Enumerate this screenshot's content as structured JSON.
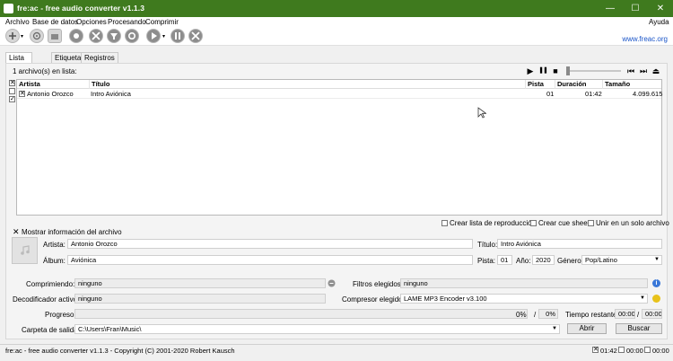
{
  "window": {
    "title": "fre:ac - free audio converter v1.1.3",
    "minimize": "—",
    "maximize": "☐",
    "close": "✕"
  },
  "menu": {
    "items": [
      "Archivo",
      "Base de datos",
      "Opciones",
      "Procesando",
      "Comprimir"
    ],
    "help": "Ayuda"
  },
  "toolbar": {
    "link": "www.freac.org",
    "icons": [
      "add-files-icon",
      "add-cd-icon",
      "add-folder-icon",
      "cddb-query-icon",
      "general-settings-icon",
      "encoder-settings-icon",
      "cover-settings-icon",
      "play-icon",
      "pause-icon",
      "stop-icon"
    ]
  },
  "tabs": [
    "Lista de tareas",
    "Etiquetas",
    "Registros"
  ],
  "joblist": {
    "count_text": "1 archivo(s) en lista:",
    "columns": [
      "Artista",
      "Título",
      "Pista",
      "Duración",
      "Tamaño"
    ],
    "rows": [
      {
        "artist": "Antonio Orozco",
        "title": "Intro Aviónica",
        "track": "01",
        "duration": "01:42",
        "size": "4.099.615"
      }
    ]
  },
  "player": {
    "play": "▶",
    "pause": "❚❚",
    "stop": "■",
    "prev": "⏮",
    "next": "⏭",
    "eject": "⏏"
  },
  "options": {
    "playlist": "Crear lista de reproducción",
    "cuesheet": "Crear cue sheet",
    "single_file": "Unir en un solo archivo"
  },
  "info": {
    "toggle": "Mostrar información del archivo",
    "artist_label": "Artista:",
    "artist": "Antonio Orozco",
    "title_label": "Título:",
    "title": "Intro Aviónica",
    "album_label": "Álbum:",
    "album": "Aviónica",
    "track_label": "Pista:",
    "track": "01",
    "year_label": "Año:",
    "year": "2020",
    "genre_label": "Género:",
    "genre": "Pop/Latino"
  },
  "encoding": {
    "compressing_label": "Comprimiendo:",
    "compressing": "ninguno",
    "filters_label": "Filtros elegidos:",
    "filters": "ninguno",
    "decoder_label": "Decodificador activo:",
    "decoder": "ninguno",
    "encoder_label": "Compresor elegido:",
    "encoder": "LAME MP3 Encoder v3.100",
    "progress_label": "Progreso:",
    "progress_file": "0%",
    "progress_sep": "/",
    "progress_total": "0%",
    "progress_fraction": 0,
    "time_label": "Tiempo restante:",
    "time_file": "00:00",
    "time_sep": "/",
    "time_total": "00:00",
    "output_label": "Carpeta de salida:",
    "output": "C:\\Users\\Fran\\Music\\",
    "open_button": "Abrir",
    "browse_button": "Buscar"
  },
  "status": {
    "text": "fre:ac - free audio converter v1.1.3 - Copyright (C) 2001-2020 Robert Kausch",
    "selected_time": "01:42",
    "unselected_time": "00:00",
    "all_time": "00:00"
  },
  "colors": {
    "titlebar": "#3f7a1e",
    "link": "#1a55c8",
    "info_icon": "#3a78d8",
    "help_icon": "#e8c21a"
  }
}
